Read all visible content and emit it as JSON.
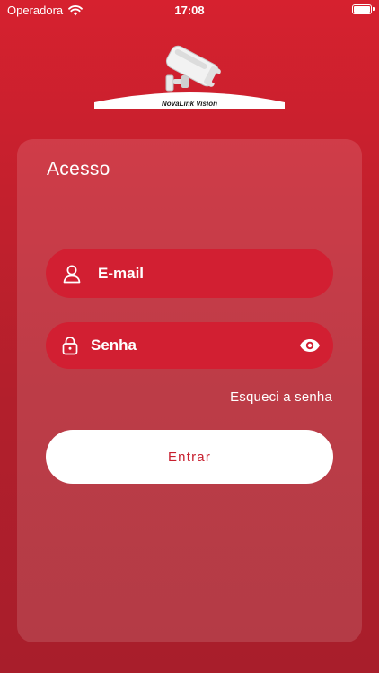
{
  "status_bar": {
    "carrier": "Operadora",
    "time": "17:08",
    "wifi_icon": "wifi-icon",
    "battery_icon": "battery-icon"
  },
  "logo": {
    "icon": "security-camera-icon",
    "brand_text": "NovaLink Vision"
  },
  "login": {
    "title": "Acesso",
    "email": {
      "placeholder": "E-mail",
      "value": "",
      "icon": "user-icon"
    },
    "password": {
      "placeholder": "Senha",
      "value": "",
      "icon": "lock-icon",
      "toggle_icon": "eye-icon"
    },
    "forgot_label": "Esqueci a senha",
    "submit_label": "Entrar"
  },
  "colors": {
    "background_top": "#d6212f",
    "background_bottom": "#a81e2b",
    "field_background": "#d21f32",
    "button_background": "#ffffff",
    "button_text": "#c8202f"
  }
}
